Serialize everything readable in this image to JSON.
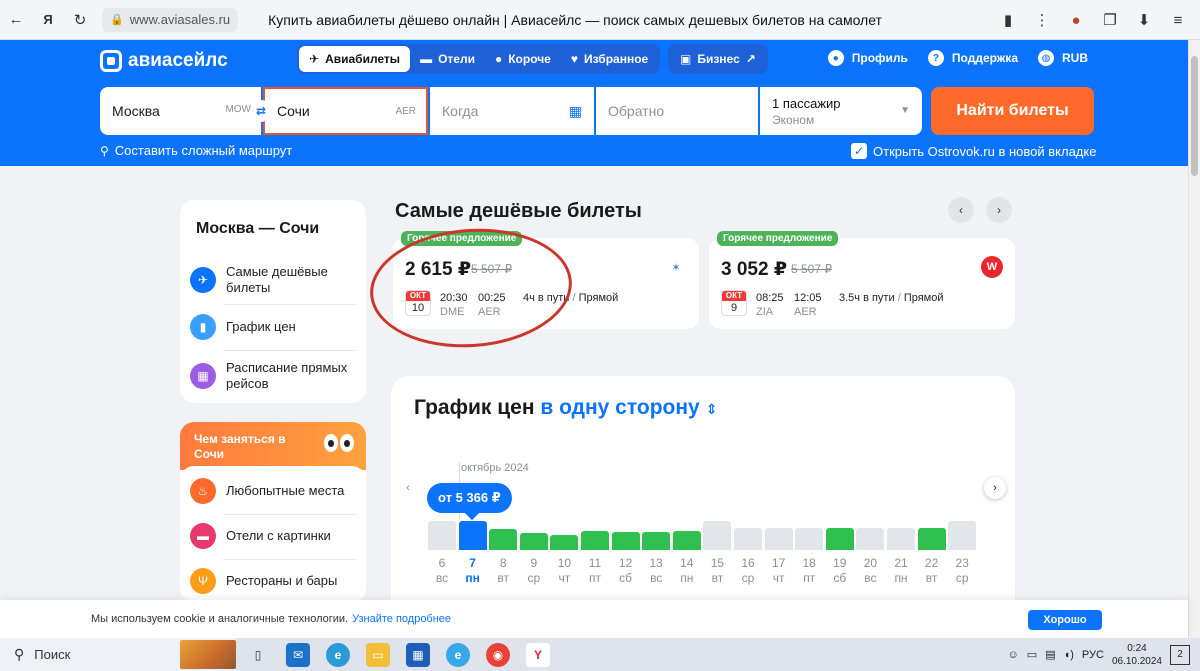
{
  "browser": {
    "url": "www.aviasales.ru",
    "title": "Купить авиабилеты дёшево онлайн | Авиасейлс — поиск самых дешевых билетов на самолет"
  },
  "header": {
    "logo": "авиасейлс",
    "tabs": [
      {
        "label": "Авиабилеты",
        "icon": "plane-icon"
      },
      {
        "label": "Отели",
        "icon": "bed-icon"
      },
      {
        "label": "Короче",
        "icon": "pin-icon"
      },
      {
        "label": "Избранное",
        "icon": "heart-icon"
      }
    ],
    "business": "Бизнес",
    "profile": "Профиль",
    "support": "Поддержка",
    "currency": "RUB"
  },
  "search": {
    "from": "Москва",
    "from_code": "MOW",
    "to": "Сочи",
    "to_code": "AER",
    "date_placeholder": "Когда",
    "return_placeholder": "Обратно",
    "passengers": "1 пассажир",
    "class": "Эконом",
    "button": "Найти билеты",
    "complex_route": "Составить сложный маршрут",
    "ostrovok": "Открыть Ostrovok.ru в новой вкладке"
  },
  "sidebar": {
    "title": "Москва — Сочи",
    "items": [
      {
        "label": "Самые дешёвые билеты",
        "icon": "plane-icon"
      },
      {
        "label": "График цен",
        "icon": "bar-chart-icon"
      },
      {
        "label": "Расписание прямых рейсов",
        "icon": "calendar-icon"
      }
    ],
    "promo": {
      "title": "Чем заняться в Сочи",
      "items": [
        {
          "label": "Любопытные места",
          "icon": "flame-icon"
        },
        {
          "label": "Отели с картинки",
          "icon": "bed-icon"
        },
        {
          "label": "Рестораны и бары",
          "icon": "fork-icon"
        }
      ]
    }
  },
  "cheapest": {
    "title": "Самые дешёвые билеты",
    "tickets": [
      {
        "badge": "Горячее предложение",
        "price": "2 615 ₽",
        "old_price": "5 507 ₽",
        "month": "ОКТ",
        "day": "10",
        "dep_time": "20:30",
        "arr_time": "00:25",
        "dep_apt": "DME",
        "arr_apt": "AER",
        "duration": "4ч в пути",
        "type": "Прямой",
        "airline_icon": "bird-logo-icon"
      },
      {
        "badge": "Горячее предложение",
        "price": "3 052 ₽",
        "old_price": "5 507 ₽",
        "month": "ОКТ",
        "day": "9",
        "dep_time": "08:25",
        "arr_time": "12:05",
        "dep_apt": "ZIA",
        "arr_apt": "AER",
        "duration": "3.5ч в пути",
        "type": "Прямой",
        "airline_icon": "red-wing-logo-icon"
      }
    ]
  },
  "price_chart": {
    "title_main": "График цен",
    "title_mode": "в одну сторону",
    "month": "октябрь 2024",
    "tooltip": "от 5 366 ₽",
    "days": [
      {
        "num": "6",
        "dow": "вс",
        "level": 0.55,
        "status": "none"
      },
      {
        "num": "7",
        "dow": "пн",
        "level": 0.55,
        "status": "selected"
      },
      {
        "num": "8",
        "dow": "вт",
        "level": 0.4,
        "status": "cheap"
      },
      {
        "num": "9",
        "dow": "ср",
        "level": 0.33,
        "status": "cheap"
      },
      {
        "num": "10",
        "dow": "чт",
        "level": 0.28,
        "status": "cheap"
      },
      {
        "num": "11",
        "dow": "пт",
        "level": 0.36,
        "status": "cheap"
      },
      {
        "num": "12",
        "dow": "сб",
        "level": 0.34,
        "status": "cheap"
      },
      {
        "num": "13",
        "dow": "вс",
        "level": 0.34,
        "status": "cheap"
      },
      {
        "num": "14",
        "dow": "пн",
        "level": 0.36,
        "status": "cheap"
      },
      {
        "num": "15",
        "dow": "вт",
        "level": 0.55,
        "status": "none"
      },
      {
        "num": "16",
        "dow": "ср",
        "level": 0.42,
        "status": "none"
      },
      {
        "num": "17",
        "dow": "чт",
        "level": 0.42,
        "status": "none"
      },
      {
        "num": "18",
        "dow": "пт",
        "level": 0.42,
        "status": "none"
      },
      {
        "num": "19",
        "dow": "сб",
        "level": 0.42,
        "status": "cheap"
      },
      {
        "num": "20",
        "dow": "вс",
        "level": 0.42,
        "status": "none"
      },
      {
        "num": "21",
        "dow": "пн",
        "level": 0.42,
        "status": "none"
      },
      {
        "num": "22",
        "dow": "вт",
        "level": 0.42,
        "status": "cheap"
      },
      {
        "num": "23",
        "dow": "ср",
        "level": 0.55,
        "status": "none"
      }
    ]
  },
  "cookie": {
    "text": "Мы используем cookie и аналогичные технологии.",
    "link": "Узнайте подробнее",
    "button": "Хорошо"
  },
  "taskbar": {
    "search": "Поиск",
    "lang": "РУС",
    "time": "0:24",
    "date": "06.10.2024",
    "notifications": "2"
  },
  "colors": {
    "brand_blue": "#0c73fe",
    "cta_orange": "#ff6a2a",
    "hot_green": "#4cb35a",
    "cheap_green": "#2fc04f",
    "empty_gray": "#e2e5ea"
  }
}
